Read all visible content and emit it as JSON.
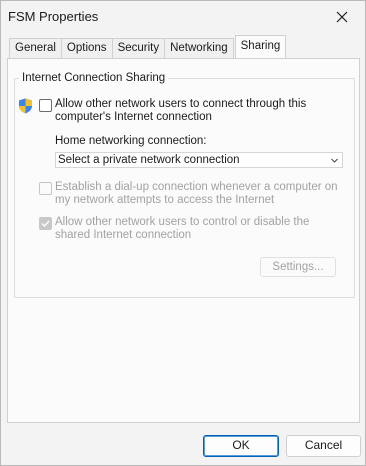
{
  "window": {
    "title": "FSM Properties"
  },
  "tabs": [
    {
      "label": "General",
      "active": false
    },
    {
      "label": "Options",
      "active": false
    },
    {
      "label": "Security",
      "active": false
    },
    {
      "label": "Networking",
      "active": false
    },
    {
      "label": "Sharing",
      "active": true
    }
  ],
  "sharing": {
    "group_title": "Internet Connection Sharing",
    "allow_connect": {
      "label_line1": "Allow other network users to connect through this",
      "label_line2": "computer's Internet connection",
      "checked": false,
      "enabled": true
    },
    "home_network": {
      "label": "Home networking connection:",
      "selected": "Select a private network connection"
    },
    "dialup": {
      "label_line1": "Establish a dial-up connection whenever a computer on",
      "label_line2": "my network attempts to access the Internet",
      "checked": false,
      "enabled": false
    },
    "allow_control": {
      "label_line1": "Allow other network users to control or disable the",
      "label_line2": "shared Internet connection",
      "checked": true,
      "enabled": false
    },
    "settings_label": "Settings..."
  },
  "footer": {
    "ok_label": "OK",
    "cancel_label": "Cancel"
  },
  "icons": {
    "shield": "uac-shield-icon",
    "close": "close-icon",
    "dropdown": "chevron-down-icon",
    "check": "check-icon"
  },
  "colors": {
    "accent": "#005fb8",
    "disabled_text": "#a2a2a2"
  }
}
